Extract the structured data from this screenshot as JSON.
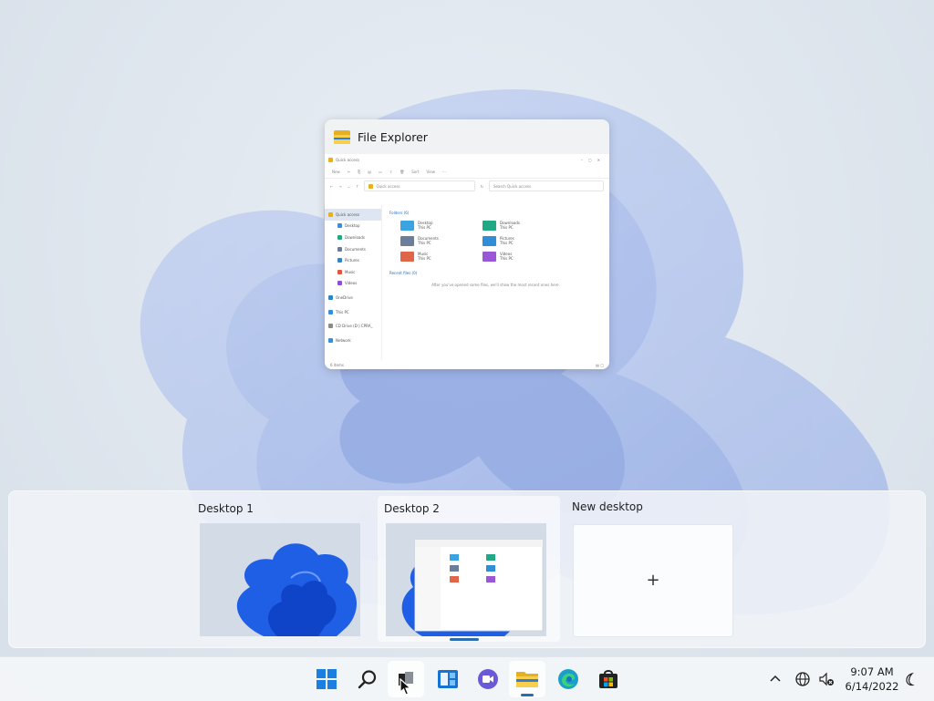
{
  "task_view": {
    "window_preview": {
      "title": "File Explorer",
      "explorer": {
        "window_title": "Quick access",
        "toolbar": [
          "New",
          "Sort",
          "View"
        ],
        "address": "Quick access",
        "search_placeholder": "Search Quick access",
        "nav": [
          "Quick access",
          "Desktop",
          "Downloads",
          "Documents",
          "Pictures",
          "Music",
          "Videos",
          "OneDrive",
          "This PC",
          "CD Drive (D:) CPRA_",
          "Network"
        ],
        "folders_header": "Folders (6)",
        "folders": [
          {
            "name": "Desktop",
            "sub": "This PC"
          },
          {
            "name": "Downloads",
            "sub": "This PC"
          },
          {
            "name": "Documents",
            "sub": "This PC"
          },
          {
            "name": "Pictures",
            "sub": "This PC"
          },
          {
            "name": "Music",
            "sub": "This PC"
          },
          {
            "name": "Videos",
            "sub": "This PC"
          }
        ],
        "recent_header": "Recent files (0)",
        "recent_empty": "After you've opened some files, we'll show the most recent ones here.",
        "status": "6 items"
      }
    },
    "desktops": [
      {
        "label": "Desktop 1"
      },
      {
        "label": "Desktop 2"
      },
      {
        "label": "New desktop"
      }
    ],
    "new_desktop_symbol": "+"
  },
  "taskbar": {
    "apps": [
      "start-icon",
      "search-icon",
      "task-view-icon",
      "widgets-icon",
      "chat-icon",
      "file-explorer-icon",
      "edge-icon",
      "store-icon"
    ],
    "clock": {
      "time": "9:07 AM",
      "date": "6/14/2022"
    }
  },
  "colors": {
    "accent": "#2b6cb0",
    "wallpaper_blue": "#2a6fe8"
  }
}
